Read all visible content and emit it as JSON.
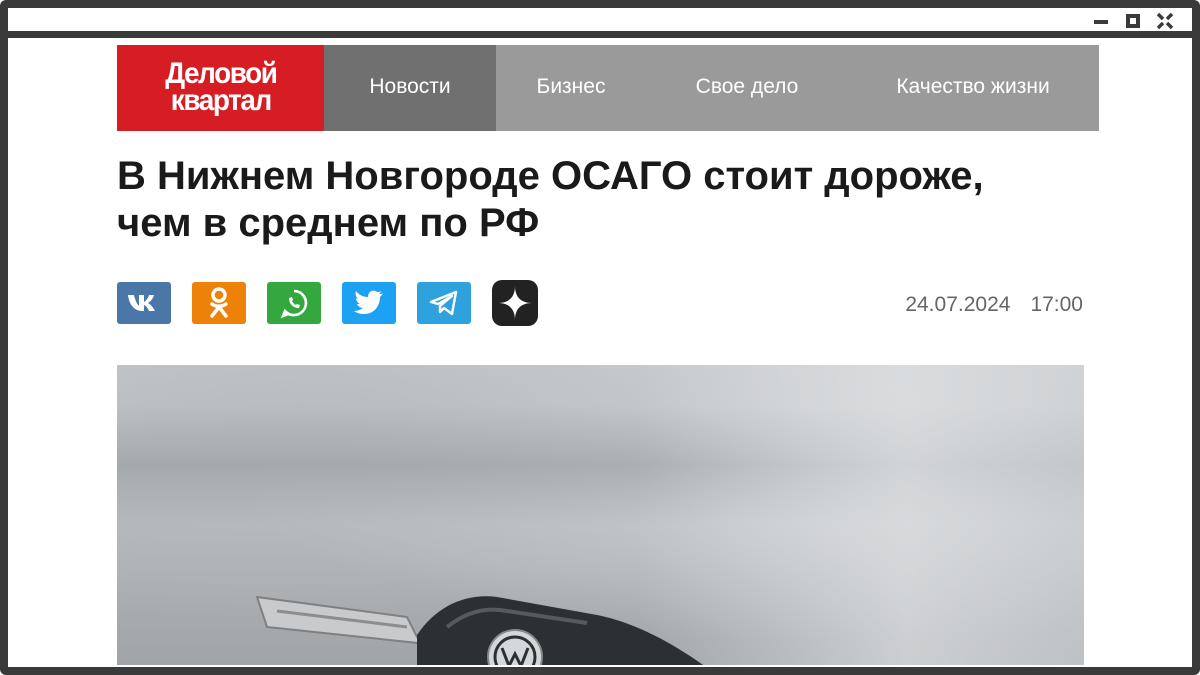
{
  "window": {
    "controls": [
      "minimize",
      "maximize",
      "close"
    ]
  },
  "site": {
    "logo_line1": "Деловой",
    "logo_line2": "квартал",
    "brand_color": "#d71d24"
  },
  "nav": {
    "items": [
      {
        "label": "Новости",
        "active": true
      },
      {
        "label": "Бизнес",
        "active": false
      },
      {
        "label": "Свое дело",
        "active": false
      },
      {
        "label": "Качество жизни",
        "active": false
      }
    ]
  },
  "article": {
    "headline": "В Нижнем Новгороде ОСАГО стоит дороже, чем в среднем по РФ",
    "date": "24.07.2024",
    "time": "17:00",
    "image_icon": "car-key-photo"
  },
  "share": {
    "buttons": [
      {
        "icon": "vk-icon",
        "color": "#4a76a8"
      },
      {
        "icon": "odnoklassniki-icon",
        "color": "#ee8208"
      },
      {
        "icon": "whatsapp-icon",
        "color": "#34a83e"
      },
      {
        "icon": "twitter-icon",
        "color": "#1da1f2"
      },
      {
        "icon": "telegram-icon",
        "color": "#2ea2dc"
      },
      {
        "icon": "dzen-icon",
        "color": "#222222"
      }
    ]
  }
}
